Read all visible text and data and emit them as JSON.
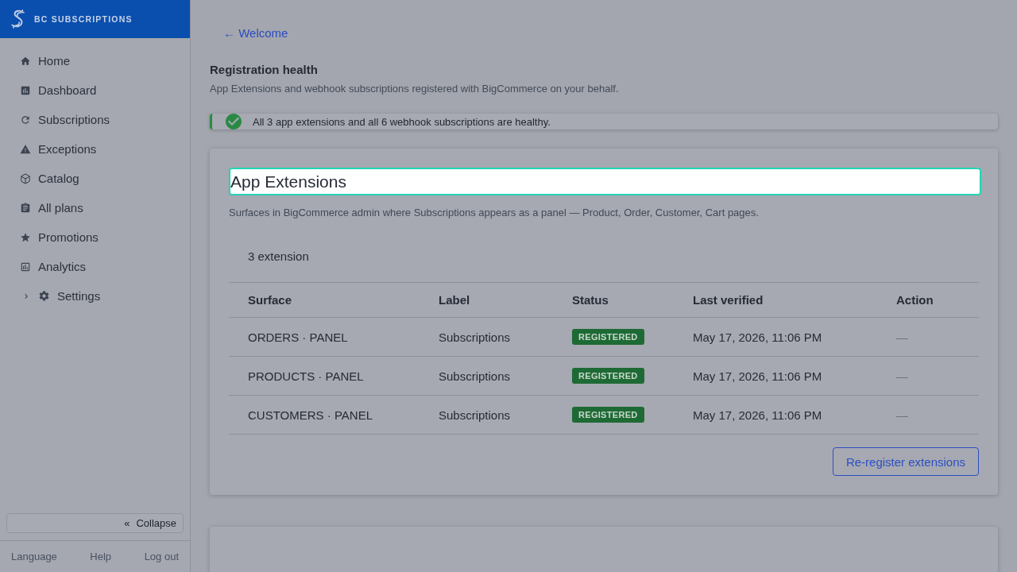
{
  "sidebar": {
    "brand": "BC SUBSCRIPTIONS",
    "nav": [
      {
        "label": "Home",
        "selected": false
      },
      {
        "label": "Dashboard",
        "selected": false
      },
      {
        "label": "Subscriptions",
        "selected": false
      },
      {
        "label": "Exceptions",
        "selected": false
      },
      {
        "label": "Catalog",
        "selected": false
      },
      {
        "label": "All plans",
        "selected": false
      },
      {
        "label": "Promotions",
        "selected": false
      },
      {
        "label": "Analytics",
        "selected": false
      }
    ],
    "settings_group": {
      "label": "Settings",
      "expanded": false,
      "selected": false
    },
    "collapse_button": {
      "icon": "«",
      "label": "Collapse"
    },
    "footer_links": [
      "Language",
      "Help",
      "Log out"
    ]
  },
  "main": {
    "back_link": "← Welcome",
    "page_title": "Registration health",
    "page_subtitle": "App Extensions and webhook subscriptions registered with BigCommerce on your behalf.",
    "alert": {
      "kind": "success",
      "text": "All 3 app extensions and all 6 webhook subscriptions are healthy."
    },
    "app_extensions": {
      "title": "App Extensions",
      "highlighted": true,
      "description": "Surfaces in BigCommerce admin where Subscriptions appears as a panel — Product, Order, Customer, Cart pages.",
      "count": "3 extension",
      "table": {
        "columns": [
          "Surface",
          "Label",
          "Status",
          "Last verified",
          "Action"
        ],
        "rows": [
          {
            "surface": "ORDERS · PANEL",
            "label": "Subscriptions",
            "status": {
              "text": "REGISTERED",
              "kind": "success"
            },
            "last_verified": "May 17, 2026, 11:06 PM",
            "action": "—"
          },
          {
            "surface": "PRODUCTS · PANEL",
            "label": "Subscriptions",
            "status": {
              "text": "REGISTERED",
              "kind": "success"
            },
            "last_verified": "May 17, 2026, 11:06 PM",
            "action": "—"
          },
          {
            "surface": "CUSTOMERS · PANEL",
            "label": "Subscriptions",
            "status": {
              "text": "REGISTERED",
              "kind": "success"
            },
            "last_verified": "May 17, 2026, 11:06 PM",
            "action": "—"
          }
        ]
      },
      "button": "Re-register extensions"
    }
  }
}
